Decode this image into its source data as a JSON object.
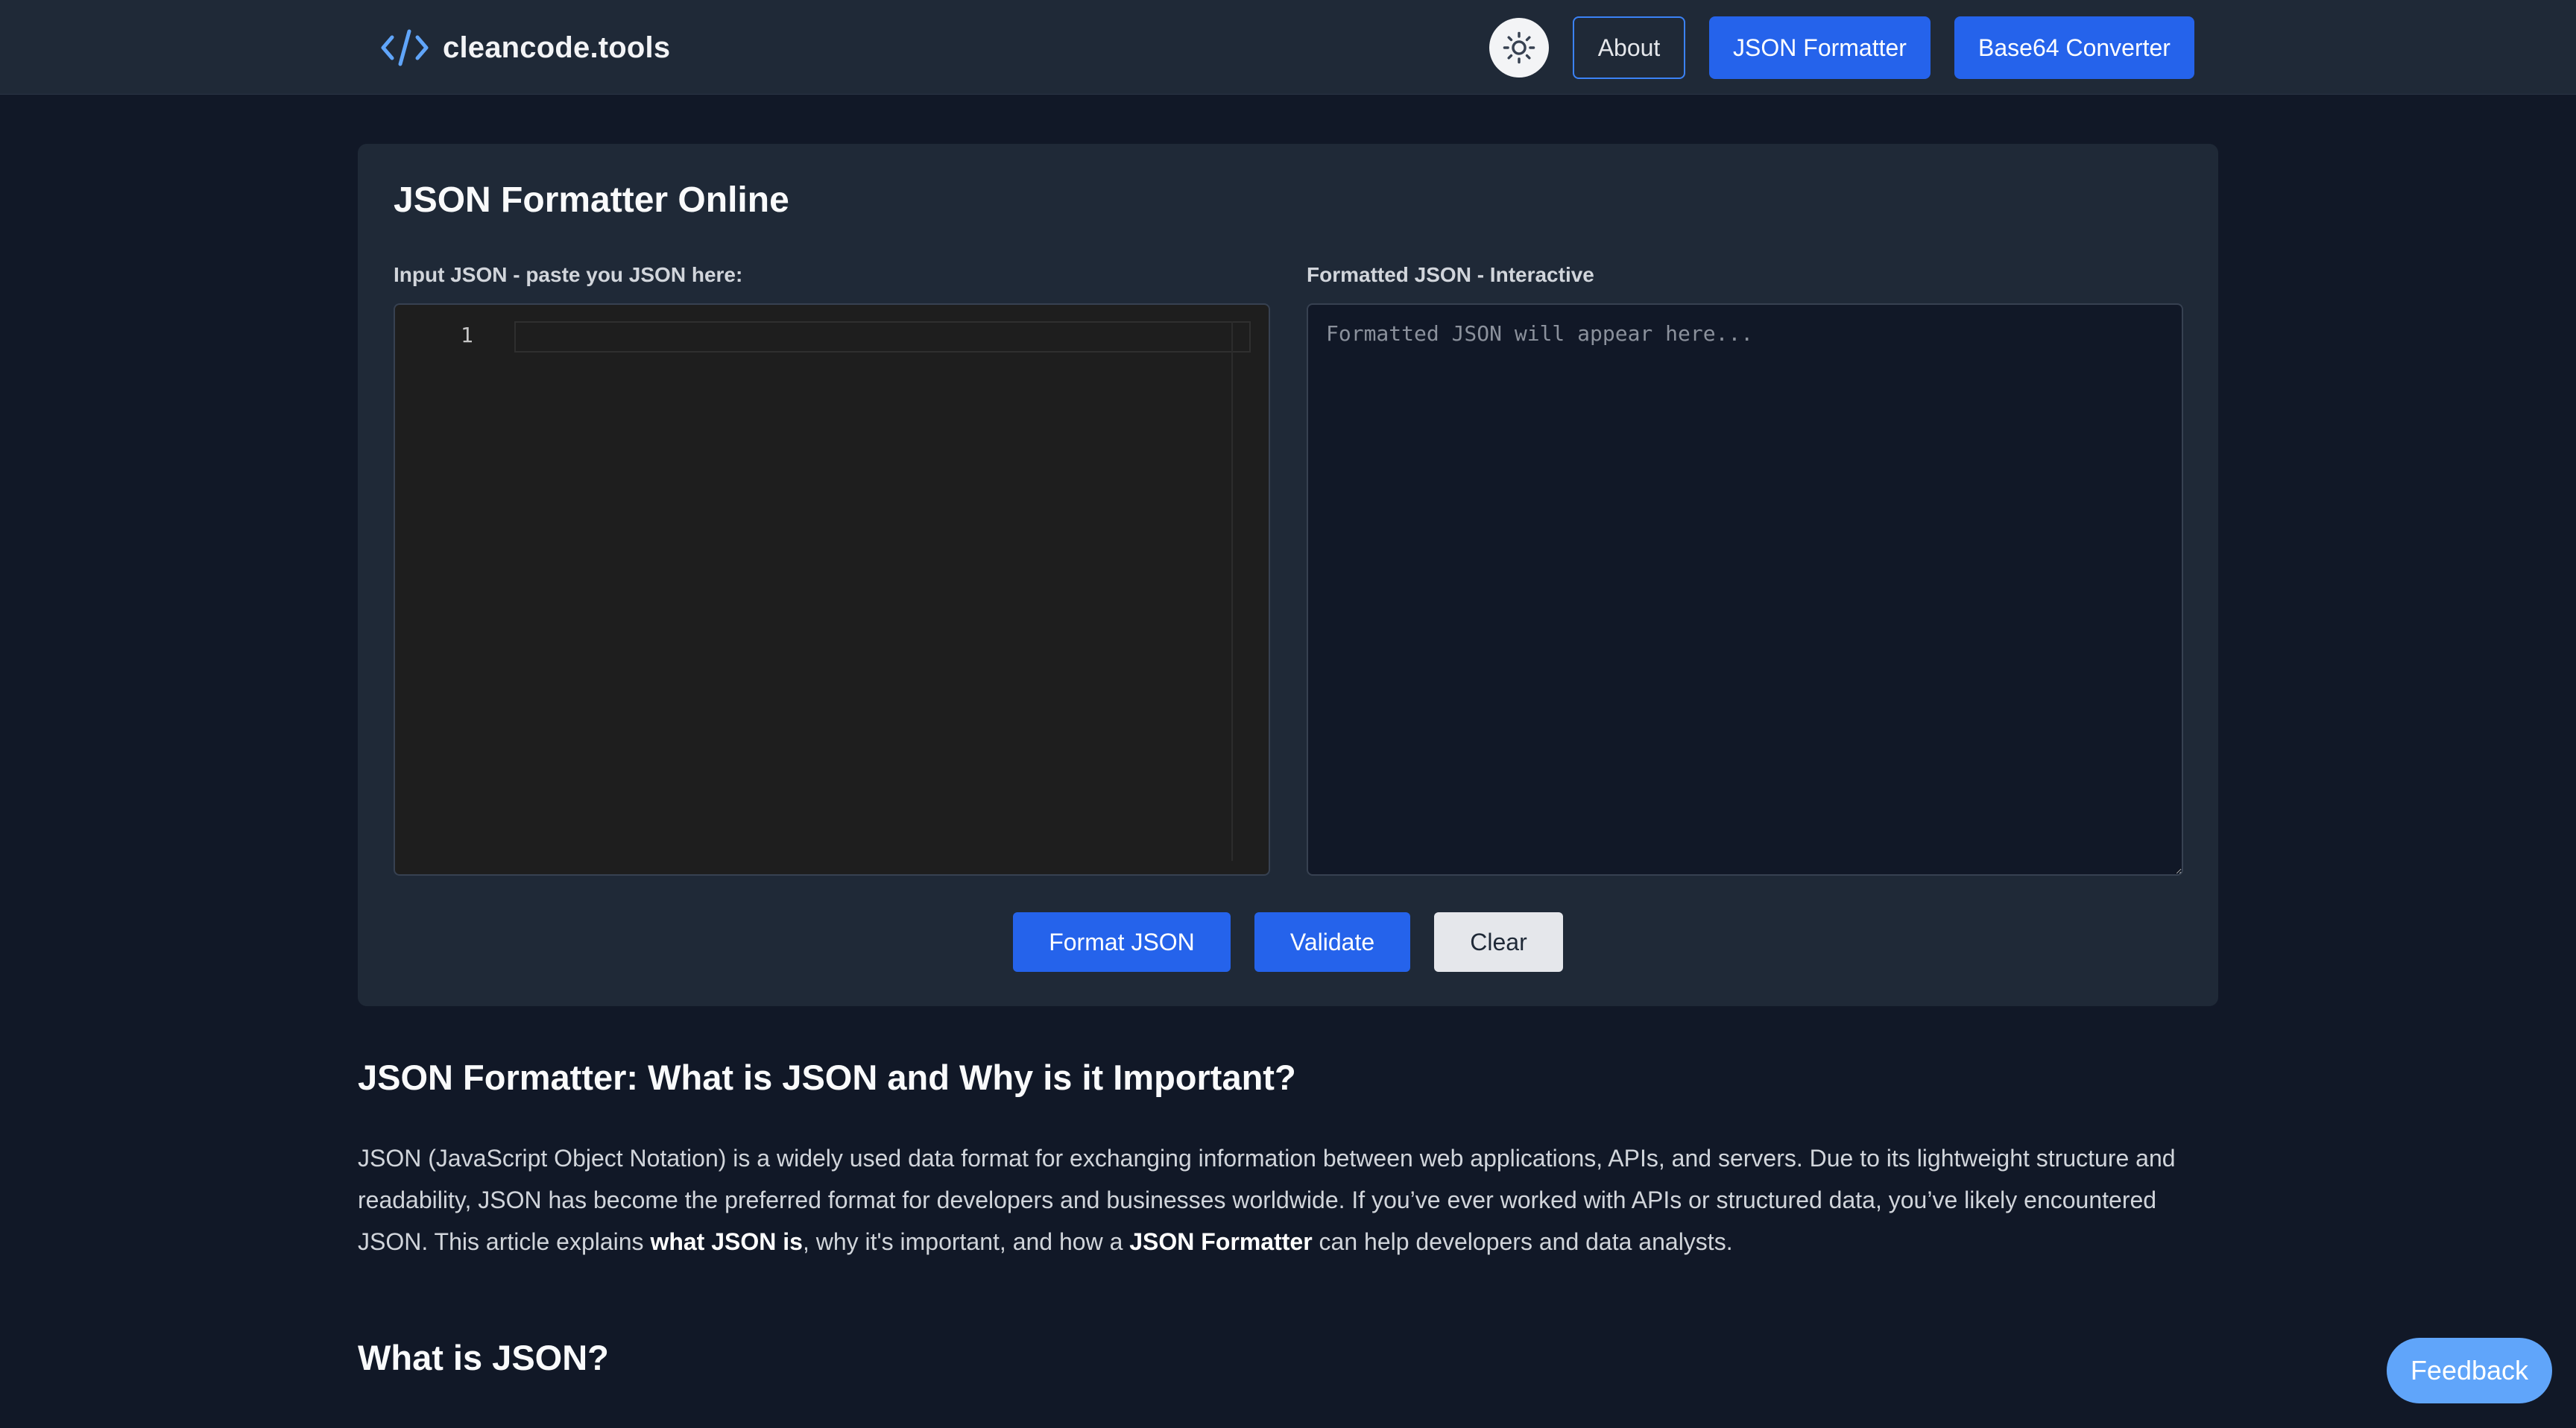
{
  "header": {
    "logo_text": "cleancode.tools",
    "logo_icon": "code-brackets-icon",
    "theme_toggle_icon": "sun-icon",
    "nav": {
      "about": "About",
      "json_formatter": "JSON Formatter",
      "base64_converter": "Base64 Converter"
    }
  },
  "tool": {
    "title": "JSON Formatter Online",
    "input_label": "Input JSON - paste you JSON here:",
    "output_label": "Formatted JSON - Interactive",
    "editor_line_number": "1",
    "output_placeholder": "Formatted JSON will appear here...",
    "buttons": {
      "format": "Format JSON",
      "validate": "Validate",
      "clear": "Clear"
    }
  },
  "article": {
    "heading1": "JSON Formatter: What is JSON and Why is it Important?",
    "paragraph": {
      "part1": "JSON (JavaScript Object Notation) is a widely used data format for exchanging information between web applications, APIs, and servers. Due to its lightweight structure and readability, JSON has become the preferred format for developers and businesses worldwide. If you’ve ever worked with APIs or structured data, you’ve likely encountered JSON. This article explains ",
      "bold1": "what JSON is",
      "part2": ", why it's important, and how a ",
      "bold2": "JSON Formatter",
      "part3": " can help developers and data analysts."
    },
    "heading2": "What is JSON?"
  },
  "feedback_label": "Feedback",
  "colors": {
    "page_background": "#111827",
    "header_background": "#1f2937",
    "card_background": "#1f2937",
    "primary_button": "#2563eb",
    "feedback_button": "#60a5fa",
    "editor_background": "#1e1e1e"
  }
}
